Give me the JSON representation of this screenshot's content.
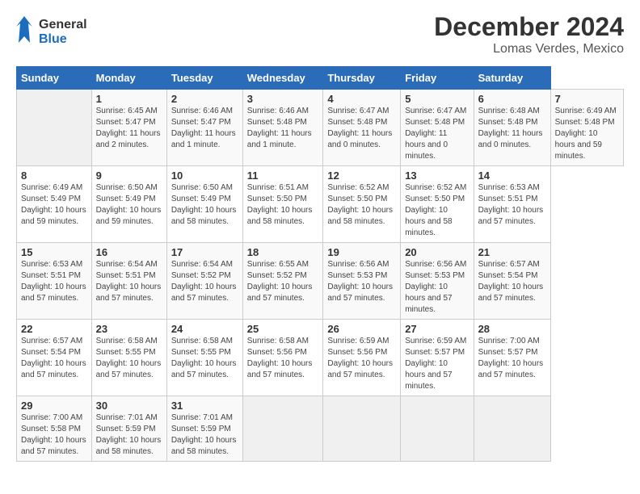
{
  "header": {
    "logo_general": "General",
    "logo_blue": "Blue",
    "month_title": "December 2024",
    "location": "Lomas Verdes, Mexico"
  },
  "calendar": {
    "days_of_week": [
      "Sunday",
      "Monday",
      "Tuesday",
      "Wednesday",
      "Thursday",
      "Friday",
      "Saturday"
    ],
    "weeks": [
      [
        null,
        {
          "day": "1",
          "sunrise": "Sunrise: 6:45 AM",
          "sunset": "Sunset: 5:47 PM",
          "daylight": "Daylight: 11 hours and 2 minutes."
        },
        {
          "day": "2",
          "sunrise": "Sunrise: 6:46 AM",
          "sunset": "Sunset: 5:47 PM",
          "daylight": "Daylight: 11 hours and 1 minute."
        },
        {
          "day": "3",
          "sunrise": "Sunrise: 6:46 AM",
          "sunset": "Sunset: 5:48 PM",
          "daylight": "Daylight: 11 hours and 1 minute."
        },
        {
          "day": "4",
          "sunrise": "Sunrise: 6:47 AM",
          "sunset": "Sunset: 5:48 PM",
          "daylight": "Daylight: 11 hours and 0 minutes."
        },
        {
          "day": "5",
          "sunrise": "Sunrise: 6:47 AM",
          "sunset": "Sunset: 5:48 PM",
          "daylight": "Daylight: 11 hours and 0 minutes."
        },
        {
          "day": "6",
          "sunrise": "Sunrise: 6:48 AM",
          "sunset": "Sunset: 5:48 PM",
          "daylight": "Daylight: 11 hours and 0 minutes."
        },
        {
          "day": "7",
          "sunrise": "Sunrise: 6:49 AM",
          "sunset": "Sunset: 5:48 PM",
          "daylight": "Daylight: 10 hours and 59 minutes."
        }
      ],
      [
        {
          "day": "8",
          "sunrise": "Sunrise: 6:49 AM",
          "sunset": "Sunset: 5:49 PM",
          "daylight": "Daylight: 10 hours and 59 minutes."
        },
        {
          "day": "9",
          "sunrise": "Sunrise: 6:50 AM",
          "sunset": "Sunset: 5:49 PM",
          "daylight": "Daylight: 10 hours and 59 minutes."
        },
        {
          "day": "10",
          "sunrise": "Sunrise: 6:50 AM",
          "sunset": "Sunset: 5:49 PM",
          "daylight": "Daylight: 10 hours and 58 minutes."
        },
        {
          "day": "11",
          "sunrise": "Sunrise: 6:51 AM",
          "sunset": "Sunset: 5:50 PM",
          "daylight": "Daylight: 10 hours and 58 minutes."
        },
        {
          "day": "12",
          "sunrise": "Sunrise: 6:52 AM",
          "sunset": "Sunset: 5:50 PM",
          "daylight": "Daylight: 10 hours and 58 minutes."
        },
        {
          "day": "13",
          "sunrise": "Sunrise: 6:52 AM",
          "sunset": "Sunset: 5:50 PM",
          "daylight": "Daylight: 10 hours and 58 minutes."
        },
        {
          "day": "14",
          "sunrise": "Sunrise: 6:53 AM",
          "sunset": "Sunset: 5:51 PM",
          "daylight": "Daylight: 10 hours and 57 minutes."
        }
      ],
      [
        {
          "day": "15",
          "sunrise": "Sunrise: 6:53 AM",
          "sunset": "Sunset: 5:51 PM",
          "daylight": "Daylight: 10 hours and 57 minutes."
        },
        {
          "day": "16",
          "sunrise": "Sunrise: 6:54 AM",
          "sunset": "Sunset: 5:51 PM",
          "daylight": "Daylight: 10 hours and 57 minutes."
        },
        {
          "day": "17",
          "sunrise": "Sunrise: 6:54 AM",
          "sunset": "Sunset: 5:52 PM",
          "daylight": "Daylight: 10 hours and 57 minutes."
        },
        {
          "day": "18",
          "sunrise": "Sunrise: 6:55 AM",
          "sunset": "Sunset: 5:52 PM",
          "daylight": "Daylight: 10 hours and 57 minutes."
        },
        {
          "day": "19",
          "sunrise": "Sunrise: 6:56 AM",
          "sunset": "Sunset: 5:53 PM",
          "daylight": "Daylight: 10 hours and 57 minutes."
        },
        {
          "day": "20",
          "sunrise": "Sunrise: 6:56 AM",
          "sunset": "Sunset: 5:53 PM",
          "daylight": "Daylight: 10 hours and 57 minutes."
        },
        {
          "day": "21",
          "sunrise": "Sunrise: 6:57 AM",
          "sunset": "Sunset: 5:54 PM",
          "daylight": "Daylight: 10 hours and 57 minutes."
        }
      ],
      [
        {
          "day": "22",
          "sunrise": "Sunrise: 6:57 AM",
          "sunset": "Sunset: 5:54 PM",
          "daylight": "Daylight: 10 hours and 57 minutes."
        },
        {
          "day": "23",
          "sunrise": "Sunrise: 6:58 AM",
          "sunset": "Sunset: 5:55 PM",
          "daylight": "Daylight: 10 hours and 57 minutes."
        },
        {
          "day": "24",
          "sunrise": "Sunrise: 6:58 AM",
          "sunset": "Sunset: 5:55 PM",
          "daylight": "Daylight: 10 hours and 57 minutes."
        },
        {
          "day": "25",
          "sunrise": "Sunrise: 6:58 AM",
          "sunset": "Sunset: 5:56 PM",
          "daylight": "Daylight: 10 hours and 57 minutes."
        },
        {
          "day": "26",
          "sunrise": "Sunrise: 6:59 AM",
          "sunset": "Sunset: 5:56 PM",
          "daylight": "Daylight: 10 hours and 57 minutes."
        },
        {
          "day": "27",
          "sunrise": "Sunrise: 6:59 AM",
          "sunset": "Sunset: 5:57 PM",
          "daylight": "Daylight: 10 hours and 57 minutes."
        },
        {
          "day": "28",
          "sunrise": "Sunrise: 7:00 AM",
          "sunset": "Sunset: 5:57 PM",
          "daylight": "Daylight: 10 hours and 57 minutes."
        }
      ],
      [
        {
          "day": "29",
          "sunrise": "Sunrise: 7:00 AM",
          "sunset": "Sunset: 5:58 PM",
          "daylight": "Daylight: 10 hours and 57 minutes."
        },
        {
          "day": "30",
          "sunrise": "Sunrise: 7:01 AM",
          "sunset": "Sunset: 5:59 PM",
          "daylight": "Daylight: 10 hours and 58 minutes."
        },
        {
          "day": "31",
          "sunrise": "Sunrise: 7:01 AM",
          "sunset": "Sunset: 5:59 PM",
          "daylight": "Daylight: 10 hours and 58 minutes."
        },
        null,
        null,
        null,
        null
      ]
    ]
  }
}
